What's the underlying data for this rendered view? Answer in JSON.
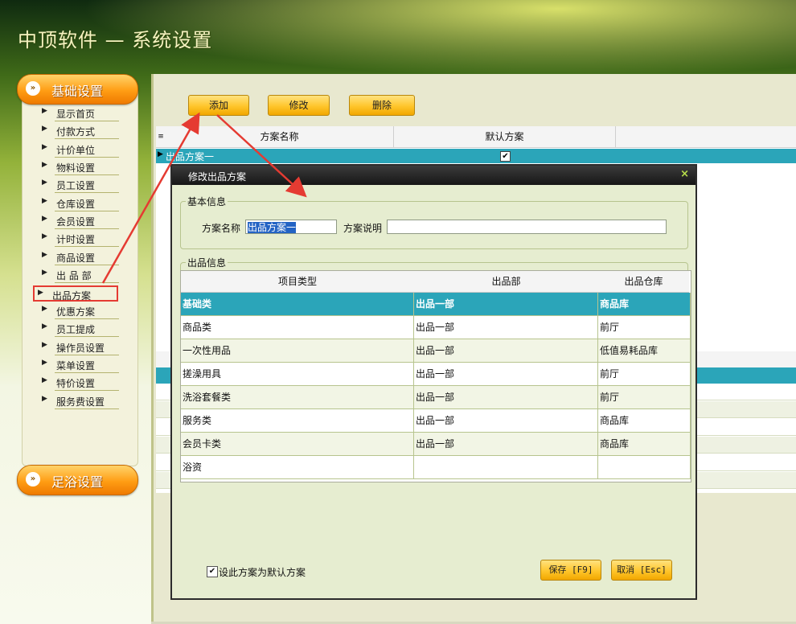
{
  "app": {
    "title": "中顶软件 — 系统设置"
  },
  "colors": {
    "accent_orange": "#ffa31a",
    "selection_teal": "#2ba5b9",
    "annotation_red": "#e53b32",
    "dialog_bg": "#e6edd0"
  },
  "sidebar": {
    "header1": {
      "label": "基础设置",
      "icon": "double-arrow-icon"
    },
    "items": [
      {
        "label": "显示首页"
      },
      {
        "label": "付款方式"
      },
      {
        "label": "计价单位"
      },
      {
        "label": "物料设置"
      },
      {
        "label": "员工设置"
      },
      {
        "label": "仓库设置"
      },
      {
        "label": "会员设置"
      },
      {
        "label": "计时设置"
      },
      {
        "label": "商品设置"
      },
      {
        "label": "出 品 部"
      },
      {
        "label": "出品方案",
        "selected": true
      },
      {
        "label": "优惠方案"
      },
      {
        "label": "员工提成"
      },
      {
        "label": "操作员设置"
      },
      {
        "label": "菜单设置"
      },
      {
        "label": "特价设置"
      },
      {
        "label": "服务费设置"
      }
    ],
    "header2": {
      "label": "足浴设置",
      "icon": "double-arrow-icon"
    }
  },
  "toolbar": {
    "add": "添加",
    "edit": "修改",
    "delete": "删除"
  },
  "plan_grid": {
    "columns": [
      "方案名称",
      "默认方案"
    ],
    "rows": [
      {
        "name": "出品方案一",
        "default": true
      }
    ]
  },
  "dialog": {
    "title": "修改出品方案",
    "close": "×",
    "basic": {
      "legend": "基本信息",
      "name_label": "方案名称",
      "name_value": "出品方案一",
      "desc_label": "方案说明",
      "desc_value": ""
    },
    "output": {
      "legend": "出品信息",
      "columns": [
        "项目类型",
        "出品部",
        "出品仓库"
      ],
      "rows": [
        {
          "type": "基础类",
          "dept": "出品一部",
          "store": "商品库"
        },
        {
          "type": "商品类",
          "dept": "出品一部",
          "store": "前厅"
        },
        {
          "type": "一次性用品",
          "dept": "出品一部",
          "store": "低值易耗品库"
        },
        {
          "type": "搓澡用具",
          "dept": "出品一部",
          "store": "前厅"
        },
        {
          "type": "洗浴套餐类",
          "dept": "出品一部",
          "store": "前厅"
        },
        {
          "type": "服务类",
          "dept": "出品一部",
          "store": "商品库"
        },
        {
          "type": "会员卡类",
          "dept": "出品一部",
          "store": "商品库"
        },
        {
          "type": "浴资",
          "dept": "",
          "store": ""
        }
      ]
    },
    "default_checkbox": {
      "label": "设此方案为默认方案",
      "checked": true
    },
    "save": "保存 [F9]",
    "cancel": "取消 [Esc]"
  }
}
